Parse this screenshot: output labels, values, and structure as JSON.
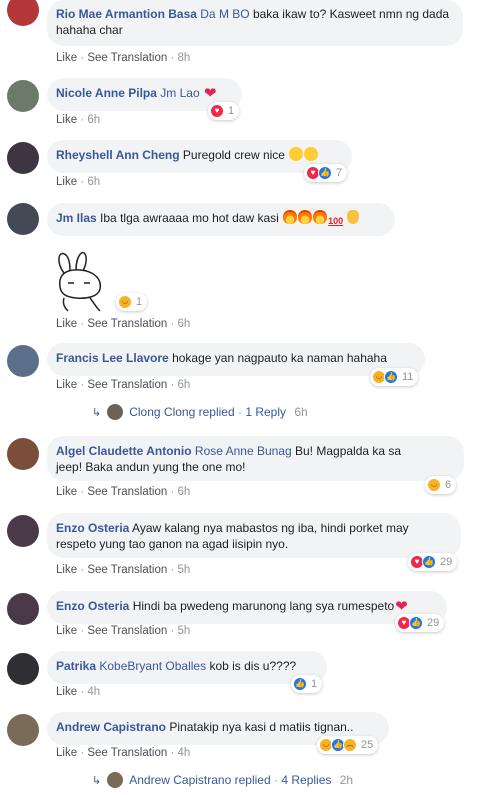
{
  "common": {
    "like": "Like",
    "see_translation": "See Translation",
    "sep": "·"
  },
  "comments": [
    {
      "author": "Rio Mae Armantion Basa",
      "tag": "Da M BO",
      "text": "baka ikaw to? Kasweet nmn ng dada hahaha char",
      "time": "8h",
      "avatar_color": "#b5373a"
    },
    {
      "author": "Nicole Anne Pilpa",
      "tag": "Jm Lao",
      "text": "",
      "time": "6h",
      "reaction_count": "1",
      "avatar_color": "#6c7a6a"
    },
    {
      "author": "Rheyshell Ann Cheng",
      "tag": "",
      "text": "Puregold crew nice",
      "time": "6h",
      "reaction_count": "7",
      "avatar_color": "#3d3540"
    },
    {
      "author": "Jm Ilas",
      "tag": "",
      "text": "Iba tlga awraaaa mo hot daw kasi",
      "time": "6h",
      "reaction_count": "1",
      "avatar_color": "#444a55"
    },
    {
      "author": "Francis Lee Llavore",
      "tag": "",
      "text": "hokage yan nagpauto ka naman hahaha",
      "time": "6h",
      "reaction_count": "11",
      "avatar_color": "#5b6f8a"
    },
    {
      "author": "Algel Claudette Antonio",
      "tag": "Rose Anne Bunag",
      "text": "Bu! Magpalda ka sa",
      "text2": "jeep! Baka andun yung the one mo!",
      "time": "6h",
      "reaction_count": "6",
      "avatar_color": "#7b4e3a"
    },
    {
      "author": "Enzo Osteria",
      "tag": "",
      "text": "Ayaw kalang nya mabastos ng iba, hindi porket may",
      "text2": "respeto yung tao ganon na agad iisipin nyo.",
      "time": "5h",
      "reaction_count": "29",
      "avatar_color": "#4a3a48"
    },
    {
      "author": "Enzo Osteria",
      "tag": "",
      "text": "Hindi ba pwedeng marunong lang sya rumespeto",
      "time": "5h",
      "reaction_count": "29",
      "avatar_color": "#4a3a48"
    },
    {
      "author": "Patrika",
      "tag": "KobeBryant Oballes",
      "text": "kob is dis u????",
      "time": "4h",
      "reaction_count": "1",
      "avatar_color": "#2f2f33"
    },
    {
      "author": "Andrew Capistrano",
      "tag": "",
      "text": "Pinatakip nya kasi d matiis tignan..",
      "time": "4h",
      "reaction_count": "25",
      "avatar_color": "#7a6a58"
    }
  ],
  "reply_threads": [
    {
      "name": "Clong Clong",
      "label": "replied",
      "count_label": "1 Reply",
      "time": "6h",
      "avatar_color": "#6d6258"
    },
    {
      "name": "Andrew Capistrano",
      "label": "replied",
      "count_label": "4 Replies",
      "time": "2h",
      "avatar_color": "#7a6a58"
    }
  ]
}
